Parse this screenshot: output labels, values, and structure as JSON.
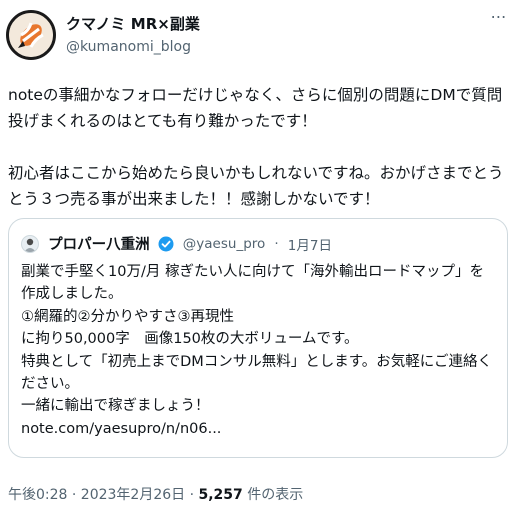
{
  "author": {
    "display_name": "クマノミ MR×副業",
    "handle": "@kumanomi_blog",
    "more_icon": "⋯"
  },
  "tweet": {
    "text": "noteの事細かなフォローだけじゃなく、さらに個別の問題にDMで質問投げまくれるのはとても有り難かったです！\n\n初心者はここから始めたら良いかもしれないですね。おかげさまでとうとう３つ売る事が出来ました！！感謝しかないです！"
  },
  "quote": {
    "name": "プロパー八重洲",
    "handle": "@yaesu_pro",
    "separator": "·",
    "date": "1月7日",
    "text": "副業で手堅く10万/月 稼ぎたい人に向けて「海外輸出ロードマップ」を作成しました。\n①網羅的②分かりやすさ③再現性\nに拘り50,000字　画像150枚の大ボリュームです。\n特典として「初売上までDMコンサル無料」とします。お気軽にご連絡ください。\n一緒に輸出で稼ぎましょう！",
    "link": "note.com/yaesupro/n/n06..."
  },
  "meta": {
    "timestamp": "午後0:28 · 2023年2月26日 · ",
    "views": "5,257",
    "views_suffix": " 件の表示"
  },
  "colors": {
    "text": "#0f1419",
    "secondary": "#536471",
    "border": "#cfd9de",
    "verified": "#1d9bf0",
    "avatar_accent": "#e8772e"
  }
}
